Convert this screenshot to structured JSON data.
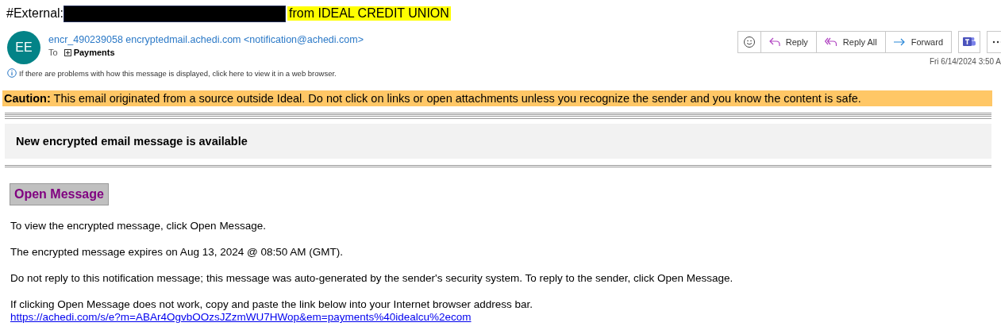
{
  "subject": {
    "prefix": "#External:",
    "redacted": true,
    "suffix": "from IDEAL CREDIT UNION"
  },
  "sender": {
    "initials": "EE",
    "from": "encr_490239058 encryptedmail.achedi.com <notification@achedi.com>",
    "to_label": "To",
    "recipient": "Payments"
  },
  "info_bar": "If there are problems with how this message is displayed, click here to view it in a web browser.",
  "toolbar": [
    {
      "kind": "emoji"
    },
    {
      "kind": "reply",
      "label": "Reply"
    },
    {
      "kind": "reply-all",
      "label": "Reply All"
    },
    {
      "kind": "forward",
      "label": "Forward"
    }
  ],
  "date": "Fri 6/14/2024 3:50 A",
  "caution": {
    "lead": "Caution:",
    "text": "This email originated from a source outside Ideal. Do not click on links or open attachments unless you recognize the sender and you know the content is safe."
  },
  "heading": "New encrypted email message is available",
  "open_button": "Open Message",
  "paragraphs": [
    "To view the encrypted message, click Open Message.",
    "The encrypted message expires on Aug 13, 2024 @ 08:50 AM (GMT).",
    "Do not reply to this notification message; this message was auto-generated by the sender's security system. To reply to the sender, click Open Message."
  ],
  "link_intro": "If clicking Open Message does not work, copy and paste the link below into your Internet browser address bar.",
  "link": "https://achedi.com/s/e?m=ABAr4OgvbOOzsJZzmWU7HWop&em=payments%40idealcu%2ecom"
}
